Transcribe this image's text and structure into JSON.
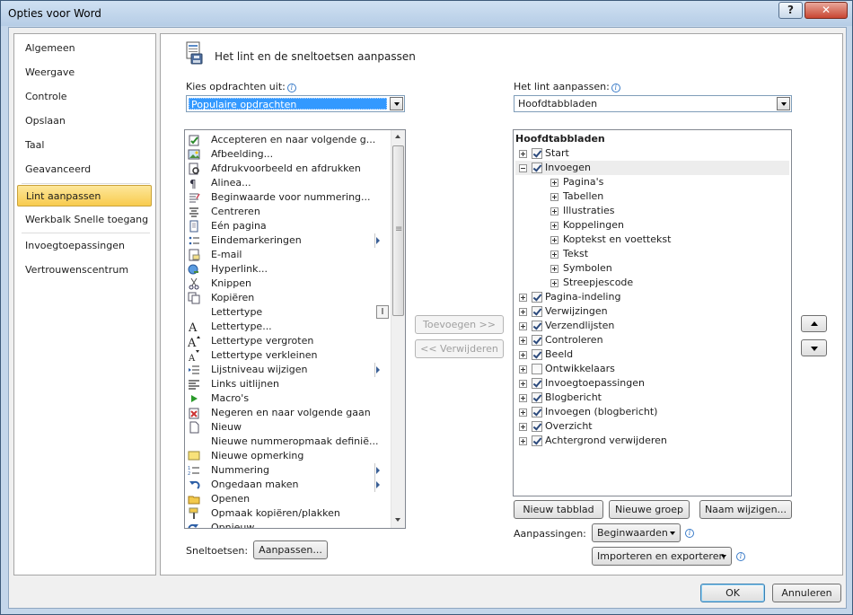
{
  "window": {
    "title": "Opties voor Word",
    "help_glyph": "?",
    "close_glyph": "✕"
  },
  "nav": {
    "items": [
      {
        "label": "Algemeen",
        "active": false
      },
      {
        "label": "Weergave",
        "active": false
      },
      {
        "label": "Controle",
        "active": false
      },
      {
        "label": "Opslaan",
        "active": false
      },
      {
        "label": "Taal",
        "active": false
      },
      {
        "label": "Geavanceerd",
        "active": false
      },
      {
        "label": "Lint aanpassen",
        "active": true
      },
      {
        "label": "Werkbalk Snelle toegang",
        "active": false
      },
      {
        "label": "Invoegtoepassingen",
        "active": false
      },
      {
        "label": "Vertrouwenscentrum",
        "active": false
      }
    ]
  },
  "main": {
    "title": "Het lint en de sneltoetsen aanpassen",
    "choose_label": "Kies opdrachten uit:",
    "choose_value": "Populaire opdrachten",
    "ribbon_label": "Het lint aanpassen:",
    "ribbon_value": "Hoofdtabbladen",
    "info_glyph": "i",
    "commands": [
      {
        "label": "Accepteren en naar volgende g...",
        "icon": "accept-icon",
        "submenu": false
      },
      {
        "label": "Afbeelding...",
        "icon": "picture-icon",
        "submenu": false
      },
      {
        "label": "Afdrukvoorbeeld en afdrukken",
        "icon": "print-preview-icon",
        "submenu": false
      },
      {
        "label": "Alinea...",
        "icon": "paragraph-icon",
        "submenu": false
      },
      {
        "label": "Beginwaarde voor nummering...",
        "icon": "numbering-value-icon",
        "submenu": false
      },
      {
        "label": "Centreren",
        "icon": "center-icon",
        "submenu": false
      },
      {
        "label": "Eén pagina",
        "icon": "one-page-icon",
        "submenu": false
      },
      {
        "label": "Eindemarkeringen",
        "icon": "bullets-icon",
        "submenu": true
      },
      {
        "label": "E-mail",
        "icon": "email-icon",
        "submenu": false
      },
      {
        "label": "Hyperlink...",
        "icon": "hyperlink-icon",
        "submenu": false
      },
      {
        "label": "Knippen",
        "icon": "cut-icon",
        "submenu": false
      },
      {
        "label": "Kopiëren",
        "icon": "copy-icon",
        "submenu": false
      },
      {
        "label": "Lettertype",
        "icon": "none",
        "submenu": false,
        "ibeam": true
      },
      {
        "label": "Lettertype...",
        "icon": "font-icon",
        "submenu": false
      },
      {
        "label": "Lettertype vergroten",
        "icon": "grow-font-icon",
        "submenu": false
      },
      {
        "label": "Lettertype verkleinen",
        "icon": "shrink-font-icon",
        "submenu": false
      },
      {
        "label": "Lijstniveau wijzigen",
        "icon": "list-level-icon",
        "submenu": true
      },
      {
        "label": "Links uitlijnen",
        "icon": "align-left-icon",
        "submenu": false
      },
      {
        "label": "Macro's",
        "icon": "macro-icon",
        "submenu": false
      },
      {
        "label": "Negeren en naar volgende gaan",
        "icon": "reject-icon",
        "submenu": false
      },
      {
        "label": "Nieuw",
        "icon": "new-document-icon",
        "submenu": false
      },
      {
        "label": "Nieuwe nummeropmaak definië...",
        "icon": "none",
        "submenu": false
      },
      {
        "label": "Nieuwe opmerking",
        "icon": "comment-icon",
        "submenu": false
      },
      {
        "label": "Nummering",
        "icon": "numbering-icon",
        "submenu": true
      },
      {
        "label": "Ongedaan maken",
        "icon": "undo-icon",
        "submenu": true
      },
      {
        "label": "Openen",
        "icon": "open-folder-icon",
        "submenu": false
      },
      {
        "label": "Opmaak kopiëren/plakken",
        "icon": "format-painter-icon",
        "submenu": false
      },
      {
        "label": "Opnieuw",
        "icon": "redo-icon",
        "submenu": false
      }
    ],
    "add_button": "Toevoegen >>",
    "remove_button": "<< Verwijderen",
    "tree_header": "Hoofdtabbladen",
    "tree": [
      {
        "label": "Start",
        "level": 0,
        "expander": "plus",
        "checked": true
      },
      {
        "label": "Invoegen",
        "level": 0,
        "expander": "minus",
        "checked": true,
        "highlight": true
      },
      {
        "label": "Pagina's",
        "level": 1,
        "expander": "plus"
      },
      {
        "label": "Tabellen",
        "level": 1,
        "expander": "plus"
      },
      {
        "label": "Illustraties",
        "level": 1,
        "expander": "plus"
      },
      {
        "label": "Koppelingen",
        "level": 1,
        "expander": "plus"
      },
      {
        "label": "Koptekst en voettekst",
        "level": 1,
        "expander": "plus"
      },
      {
        "label": "Tekst",
        "level": 1,
        "expander": "plus"
      },
      {
        "label": "Symbolen",
        "level": 1,
        "expander": "plus"
      },
      {
        "label": "Streepjescode",
        "level": 1,
        "expander": "plus"
      },
      {
        "label": "Pagina-indeling",
        "level": 0,
        "expander": "plus",
        "checked": true
      },
      {
        "label": "Verwijzingen",
        "level": 0,
        "expander": "plus",
        "checked": true
      },
      {
        "label": "Verzendlijsten",
        "level": 0,
        "expander": "plus",
        "checked": true
      },
      {
        "label": "Controleren",
        "level": 0,
        "expander": "plus",
        "checked": true
      },
      {
        "label": "Beeld",
        "level": 0,
        "expander": "plus",
        "checked": true
      },
      {
        "label": "Ontwikkelaars",
        "level": 0,
        "expander": "plus",
        "checked": false
      },
      {
        "label": "Invoegtoepassingen",
        "level": 0,
        "expander": "plus",
        "checked": true
      },
      {
        "label": "Blogbericht",
        "level": 0,
        "expander": "plus",
        "checked": true
      },
      {
        "label": "Invoegen (blogbericht)",
        "level": 0,
        "expander": "plus",
        "checked": true
      },
      {
        "label": "Overzicht",
        "level": 0,
        "expander": "plus",
        "checked": true
      },
      {
        "label": "Achtergrond verwijderen",
        "level": 0,
        "expander": "plus",
        "checked": true
      }
    ],
    "new_tab_button": "Nieuw tabblad",
    "new_group_button": "Nieuwe groep",
    "rename_button": "Naam wijzigen...",
    "customizations_label": "Aanpassingen:",
    "reset_button": "Beginwaarden",
    "import_export_button": "Importeren en exporteren",
    "shortcuts_label": "Sneltoetsen:",
    "customize_button": "Aanpassen..."
  },
  "footer": {
    "ok_button": "OK",
    "cancel_button": "Annuleren"
  }
}
